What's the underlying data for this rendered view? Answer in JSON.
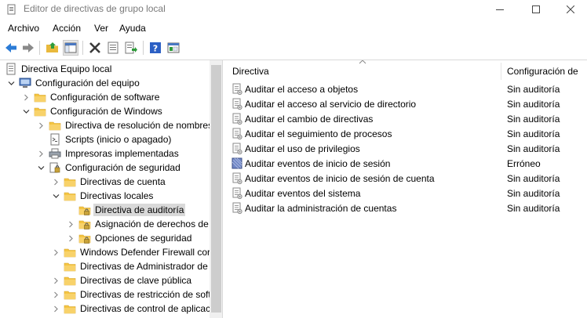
{
  "window": {
    "title": "Editor de directivas de grupo local"
  },
  "menu": {
    "items": [
      "Archivo",
      "Acción",
      "Ver",
      "Ayuda"
    ]
  },
  "toolbar": {
    "buttons": [
      "back-icon",
      "forward-icon",
      "up-folder-icon",
      "show-tree-icon",
      "delete-icon",
      "properties-icon",
      "export-list-icon",
      "help-icon",
      "mmc-view-icon"
    ]
  },
  "tree": {
    "nodes": [
      {
        "label": "Directiva Equipo local",
        "icon": "policy-document-icon",
        "indent": 0,
        "twisty": ""
      },
      {
        "label": "Configuración del equipo",
        "icon": "computer-icon",
        "indent": 1,
        "twisty": "open"
      },
      {
        "label": "Configuración de software",
        "icon": "folder-icon",
        "indent": 2,
        "twisty": "closed"
      },
      {
        "label": "Configuración de Windows",
        "icon": "folder-icon",
        "indent": 2,
        "twisty": "open"
      },
      {
        "label": "Directiva de resolución de nombres",
        "icon": "folder-icon",
        "indent": 3,
        "twisty": "closed"
      },
      {
        "label": "Scripts (inicio o apagado)",
        "icon": "script-icon",
        "indent": 3,
        "twisty": ""
      },
      {
        "label": "Impresoras implementadas",
        "icon": "printer-icon",
        "indent": 3,
        "twisty": "closed"
      },
      {
        "label": "Configuración de seguridad",
        "icon": "security-icon",
        "indent": 3,
        "twisty": "open"
      },
      {
        "label": "Directivas de cuenta",
        "icon": "folder-icon",
        "indent": 4,
        "twisty": "closed"
      },
      {
        "label": "Directivas locales",
        "icon": "folder-icon",
        "indent": 4,
        "twisty": "open"
      },
      {
        "label": "Directiva de auditoría",
        "icon": "locked-folder-icon",
        "indent": 5,
        "twisty": "",
        "selected": true
      },
      {
        "label": "Asignación de derechos de",
        "icon": "locked-folder-icon",
        "indent": 5,
        "twisty": "closed"
      },
      {
        "label": "Opciones de seguridad",
        "icon": "locked-folder-icon",
        "indent": 5,
        "twisty": "closed"
      },
      {
        "label": "Windows Defender Firewall cor",
        "icon": "folder-icon",
        "indent": 4,
        "twisty": "closed"
      },
      {
        "label": "Directivas de Administrador de",
        "icon": "folder-icon",
        "indent": 4,
        "twisty": ""
      },
      {
        "label": "Directivas de clave pública",
        "icon": "folder-icon",
        "indent": 4,
        "twisty": "closed"
      },
      {
        "label": "Directivas de restricción de soft",
        "icon": "folder-icon",
        "indent": 4,
        "twisty": "closed"
      },
      {
        "label": "Directivas de control de aplicac",
        "icon": "folder-icon",
        "indent": 4,
        "twisty": "closed"
      }
    ]
  },
  "list": {
    "columns": [
      "Directiva",
      "Configuración de"
    ],
    "rows": [
      {
        "name": "Auditar el acceso a objetos",
        "value": "Sin auditoría",
        "icon": "policy-item-icon"
      },
      {
        "name": "Auditar el acceso al servicio de directorio",
        "value": "Sin auditoría",
        "icon": "policy-item-icon"
      },
      {
        "name": "Auditar el cambio de directivas",
        "value": "Sin auditoría",
        "icon": "policy-item-icon"
      },
      {
        "name": "Auditar el seguimiento de procesos",
        "value": "Sin auditoría",
        "icon": "policy-item-icon"
      },
      {
        "name": "Auditar el uso de privilegios",
        "value": "Sin auditoría",
        "icon": "policy-item-icon"
      },
      {
        "name": "Auditar eventos de inicio de sesión",
        "value": "Erróneo",
        "icon": "policy-item-modified-icon"
      },
      {
        "name": "Auditar eventos de inicio de sesión de cuenta",
        "value": "Sin auditoría",
        "icon": "policy-item-icon"
      },
      {
        "name": "Auditar eventos del sistema",
        "value": "Sin auditoría",
        "icon": "policy-item-icon"
      },
      {
        "name": "Auditar la administración de cuentas",
        "value": "Sin auditoría",
        "icon": "policy-item-icon"
      }
    ]
  },
  "colors": {
    "selection": "#d9d9d9",
    "folder": "#f5c542",
    "accent": "#1e73c8"
  }
}
